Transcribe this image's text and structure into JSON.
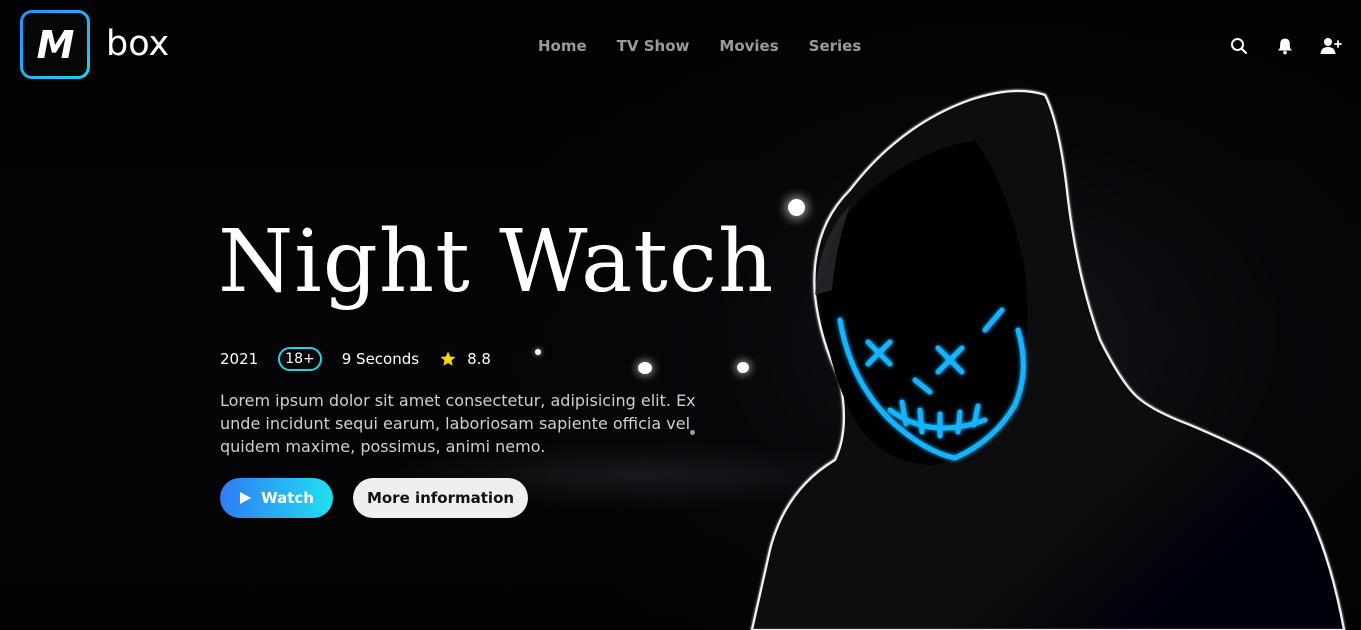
{
  "brand": {
    "logo_letter": "M",
    "name": "box",
    "gradient_start": "#2a8cff",
    "gradient_end": "#18d6f0"
  },
  "nav": {
    "items": [
      {
        "label": "Home"
      },
      {
        "label": "TV Show"
      },
      {
        "label": "Movies"
      },
      {
        "label": "Series"
      }
    ]
  },
  "header_icons": [
    "search-icon",
    "bell-icon",
    "add-user-icon"
  ],
  "hero": {
    "title": "Night Watch",
    "year": "2021",
    "age_rating": "18+",
    "duration": "9 Seconds",
    "score": "8.8",
    "description": "Lorem ipsum dolor sit amet consectetur, adipisicing elit. Ex unde incidunt sequi earum, laboriosam sapiente officia vel quidem maxime, possimus, animi nemo.",
    "watch_label": "Watch",
    "more_label": "More information",
    "accent_color": "#1fd3e8",
    "star_color": "#f5d90a"
  }
}
